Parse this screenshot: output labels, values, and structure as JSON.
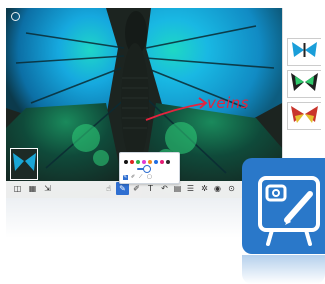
{
  "annotation": {
    "text": "veins"
  },
  "pen_popup": {
    "colors": [
      "#111111",
      "#e02323",
      "#2ab24a",
      "#e23bd2",
      "#f08a1e",
      "#1f6ee2",
      "#e61b75",
      "#2b2b2b"
    ]
  },
  "colors": {
    "accent": "#2f6fd1",
    "annotation": "#e5233e",
    "app_icon_bg": "#2a78c9",
    "butterfly_blue": "#1ab1e0"
  },
  "icons": [
    "settings-icon",
    "camera-icon",
    "pen-icon",
    "hand-icon",
    "pointer-icon",
    "highlighter-icon",
    "eraser-icon",
    "text-icon",
    "undo-icon",
    "redo-icon",
    "freeze-icon",
    "capture-icon",
    "record-icon",
    "close-icon",
    "whiteboard-icon"
  ]
}
